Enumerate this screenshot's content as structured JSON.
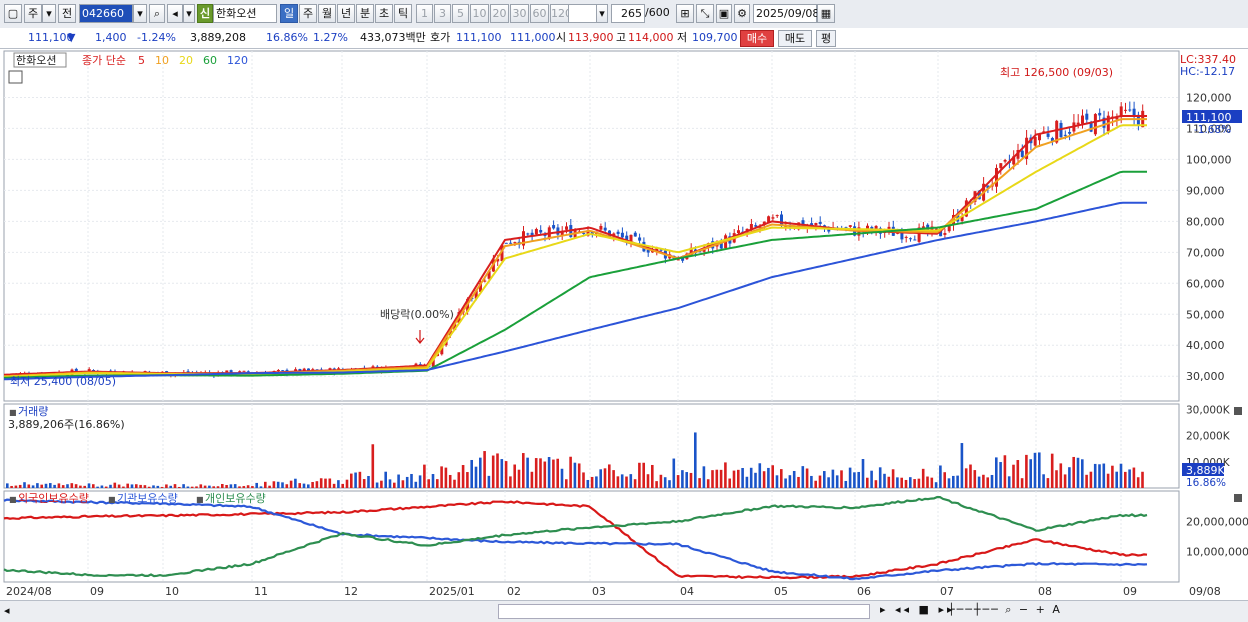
{
  "toolbar": {
    "market": "주",
    "mode": "전",
    "code": "042660",
    "badge": "신",
    "name": "한화오션",
    "periods": [
      "일",
      "주",
      "월",
      "년",
      "분",
      "초",
      "틱"
    ],
    "active_period": "일",
    "counts": [
      "1",
      "3",
      "5",
      "10",
      "20",
      "30",
      "60",
      "120"
    ],
    "range_current": "265",
    "range_total": "/600",
    "date": "2025/09/08"
  },
  "quote": {
    "price": "111,100",
    "down_mark": "▼",
    "change": "1,400",
    "change_pct": "-1.24%",
    "volume": "3,889,208",
    "turnover_pct": "16.86%",
    "ratio": "1.27%",
    "amount": "433,073백만",
    "hoga_label": "호가",
    "bid": "111,100",
    "ask": "111,000",
    "open_label": "시",
    "open": "113,900",
    "high_label": "고",
    "high": "114,000",
    "low_label": "저",
    "low": "109,700",
    "buy_button": "매수",
    "sell_button": "매도",
    "eval_button": "평"
  },
  "price_panel": {
    "name_tag": "한화오션",
    "ma_legend": {
      "label": "종가 단순",
      "periods": [
        "5",
        "10",
        "20",
        "60",
        "120"
      ],
      "colors": [
        "#d81e1e",
        "#f0a020",
        "#e8d818",
        "#1aa03a",
        "#2c54d8"
      ]
    },
    "lc": "LC:337.40",
    "hc": "HC:-12.17",
    "high_note": "최고 126,500 (09/03)",
    "low_note": "최저 25,400 (08/05)",
    "dividend_note": "배당락(0.00%)",
    "current_tag": "111,100",
    "current_pct": "-1.68%",
    "y_labels": [
      "120,000",
      "110,000",
      "100,000",
      "90,000",
      "80,000",
      "70,000",
      "60,000",
      "50,000",
      "40,000",
      "30,000"
    ]
  },
  "volume_panel": {
    "title": "거래량",
    "last": "3,889,206주(16.86%)",
    "y_labels": [
      "30,000K",
      "20,000K",
      "10,000K"
    ],
    "current_tag": "3,889K",
    "current_pct": "16.86%"
  },
  "holding_panel": {
    "legend": [
      "외국인보유수량",
      "기관보유수량",
      "개인보유수량"
    ],
    "colors": [
      "#d81818",
      "#2c58d8",
      "#2e8e50"
    ],
    "y_labels": [
      "20,000,000",
      "10,000,000"
    ]
  },
  "x_axis": [
    "2024/08",
    "09",
    "10",
    "11",
    "12",
    "2025/01",
    "02",
    "03",
    "04",
    "05",
    "06",
    "07",
    "08",
    "09",
    "09/08"
  ],
  "chart_data": [
    {
      "type": "candlestick",
      "x_axis_labels": [
        "2024/08",
        "09",
        "10",
        "11",
        "12",
        "2025/01",
        "02",
        "03",
        "04",
        "05",
        "06",
        "07",
        "08",
        "09"
      ],
      "ylim": [
        22000,
        135000
      ],
      "y_ticks": [
        30000,
        40000,
        50000,
        60000,
        70000,
        80000,
        90000,
        100000,
        110000,
        120000
      ],
      "series": [
        {
          "name": "5",
          "values_by_month": [
            30500,
            31500,
            31000,
            31000,
            32000,
            33500,
            74000,
            78000,
            68000,
            80000,
            77000,
            76000,
            108000,
            114000
          ]
        },
        {
          "name": "10",
          "values_by_month": [
            30000,
            31200,
            30800,
            30800,
            31800,
            33000,
            72000,
            77000,
            68000,
            79000,
            77000,
            76500,
            104000,
            113000
          ]
        },
        {
          "name": "20",
          "values_by_month": [
            29800,
            31000,
            30700,
            30500,
            31500,
            32500,
            68000,
            76000,
            70000,
            78000,
            77500,
            77000,
            96000,
            111000
          ]
        },
        {
          "name": "60",
          "values_by_month": [
            29500,
            30200,
            30300,
            30200,
            30800,
            31800,
            45000,
            62000,
            68000,
            74000,
            76000,
            78000,
            84000,
            96000
          ]
        },
        {
          "name": "120",
          "values_by_month": [
            29000,
            29800,
            30300,
            31000,
            31200,
            32000,
            38000,
            45000,
            52000,
            62000,
            68000,
            74000,
            80000,
            86000
          ]
        }
      ],
      "close": 111100,
      "high": {
        "value": 126500,
        "date": "09/03"
      },
      "low": {
        "value": 25400,
        "date": "08/05"
      }
    },
    {
      "type": "bar",
      "name": "거래량",
      "ylim": [
        0,
        32000
      ],
      "y_ticks": [
        10000,
        20000,
        30000
      ],
      "last": 3889
    },
    {
      "type": "line",
      "name": "holdings",
      "ylim": [
        0,
        30000000
      ],
      "y_ticks": [
        10000000,
        20000000
      ],
      "series": [
        {
          "name": "외국인보유수량",
          "values": [
            21000000,
            21600000,
            21900000,
            22400000,
            23000000,
            24800000,
            26500000,
            24900000,
            2000000,
            1500000,
            1800000,
            6000000,
            14000000,
            9000000
          ]
        },
        {
          "name": "기관보유수량",
          "values": [
            27000000,
            26300000,
            25900000,
            24800000,
            15800000,
            14500000,
            13200000,
            12700000,
            12500000,
            3500000,
            1000000,
            3800000,
            6000000,
            5800000
          ]
        },
        {
          "name": "개인보유수량",
          "values": [
            4000000,
            2300000,
            2200000,
            6000000,
            16000000,
            12000000,
            15500000,
            18000000,
            20000000,
            25000000,
            24500000,
            28000000,
            17000000,
            22000000
          ]
        }
      ]
    }
  ]
}
